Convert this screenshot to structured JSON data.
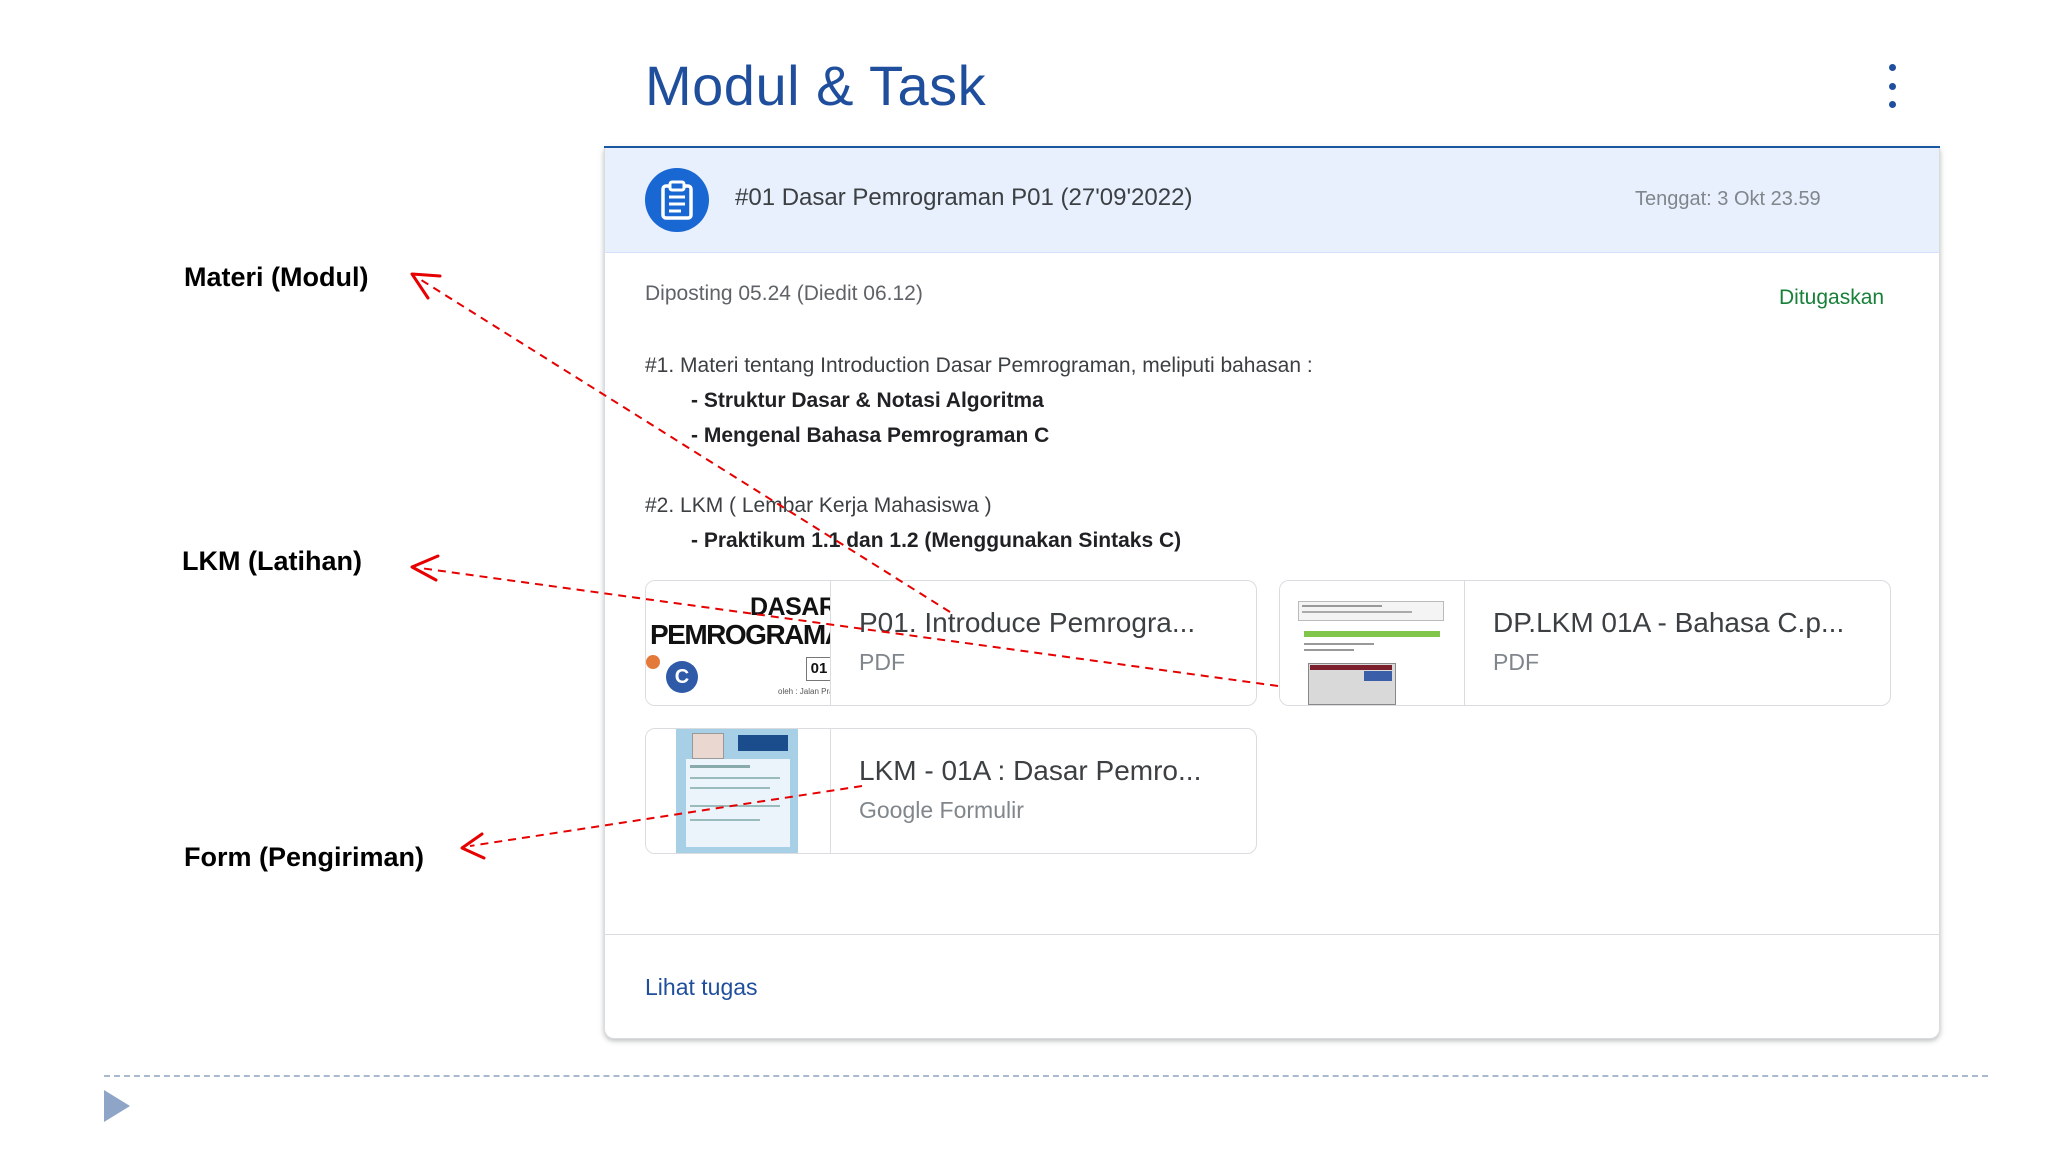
{
  "header": {
    "title": "Modul & Task",
    "menu_icon": "more-vert-icon"
  },
  "card": {
    "icon": "assignment-icon",
    "title": "#01 Dasar Pemrograman P01 (27'09'2022)",
    "due": "Tenggat: 3 Okt 23.59",
    "posted": "Diposting 05.24 (Diedit 06.12)",
    "status": "Ditugaskan",
    "description": {
      "line1": "#1. Materi tentang Introduction Dasar Pemrograman, meliputi bahasan :",
      "line2": "- Struktur Dasar & Notasi Algoritma",
      "line3": "- Mengenal Bahasa Pemrograman C",
      "line4": "#2. LKM ( Lembar Kerja Mahasiswa )",
      "line5": "- Praktikum 1.1 dan 1.2 (Menggunakan Sintaks C)"
    },
    "attachments": [
      {
        "name": "P01. Introduce Pemrogra...",
        "type": "PDF",
        "thumb_line1": "DASAR",
        "thumb_line2": "PEMROGRAMAN",
        "thumb_number": "01",
        "thumb_footer": "oleh : Jalan Pratama"
      },
      {
        "name": "DP.LKM 01A - Bahasa C.p...",
        "type": "PDF"
      },
      {
        "name": "LKM - 01A : Dasar Pemro...",
        "type": "Google Formulir"
      }
    ],
    "view_link": "Lihat tugas"
  },
  "annotations": {
    "materi": "Materi (Modul)",
    "lkm": "LKM (Latihan)",
    "form": "Form (Pengiriman)"
  },
  "colors": {
    "title": "#1f4e9c",
    "header_bg": "#e8f0fe",
    "icon_bg": "#1967d2",
    "status": "#188038",
    "arrow": "#e60000"
  }
}
